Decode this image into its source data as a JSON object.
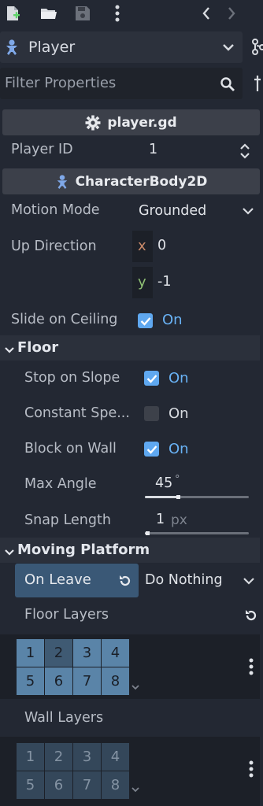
{
  "toolbar": {
    "icons": [
      "new-script-icon",
      "open-folder-icon",
      "save-icon",
      "more-vertical-icon",
      "history-back-icon",
      "history-forward-icon"
    ]
  },
  "node_selector": {
    "label": "Player"
  },
  "filter": {
    "placeholder": "Filter Properties"
  },
  "script": {
    "name": "player.gd"
  },
  "player_id": {
    "label": "Player ID",
    "value": "1"
  },
  "class": {
    "name": "CharacterBody2D"
  },
  "motion_mode": {
    "label": "Motion Mode",
    "value": "Grounded"
  },
  "up_direction": {
    "label": "Up Direction",
    "x_axis": "x",
    "x_value": "0",
    "y_axis": "y",
    "y_value": "-1"
  },
  "slide_on_ceiling": {
    "label": "Slide on Ceiling",
    "checked": true,
    "state": "On"
  },
  "floor": {
    "title": "Floor",
    "stop_on_slope": {
      "label": "Stop on Slope",
      "checked": true,
      "state": "On"
    },
    "constant_speed": {
      "label": "Constant Spe...",
      "checked": false,
      "state": "On"
    },
    "block_on_wall": {
      "label": "Block on Wall",
      "checked": true,
      "state": "On"
    },
    "max_angle": {
      "label": "Max Angle",
      "value": "45",
      "unit": "°",
      "fraction": 0.32
    },
    "snap_length": {
      "label": "Snap Length",
      "value": "1",
      "unit": "px",
      "fraction": 0.02
    }
  },
  "moving_platform": {
    "title": "Moving Platform",
    "on_leave": {
      "label": "On Leave",
      "value": "Do Nothing"
    },
    "floor_layers": {
      "label": "Floor Layers",
      "cells": [
        "1",
        "2",
        "3",
        "4",
        "5",
        "6",
        "7",
        "8"
      ],
      "active": [
        true,
        false,
        true,
        true,
        true,
        true,
        true,
        true
      ]
    },
    "wall_layers": {
      "label": "Wall Layers",
      "cells": [
        "1",
        "2",
        "3",
        "4",
        "5",
        "6",
        "7",
        "8"
      ]
    }
  },
  "colors": {
    "accent": "#5fa8f0",
    "on_text": "#69b2f5",
    "selected_row": "#3a5876",
    "node_icon": "#7fa8e8"
  }
}
